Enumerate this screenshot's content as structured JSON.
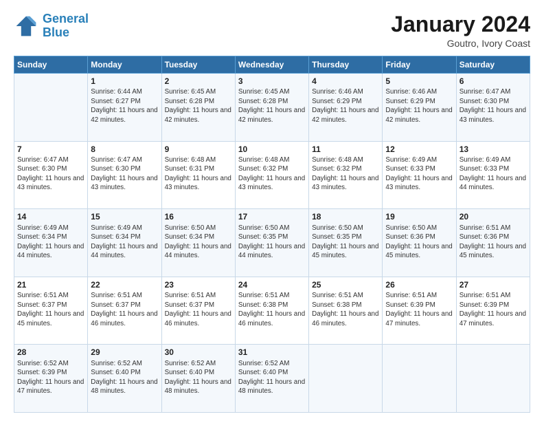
{
  "header": {
    "logo_line1": "General",
    "logo_line2": "Blue",
    "month": "January 2024",
    "location": "Goutro, Ivory Coast"
  },
  "days_of_week": [
    "Sunday",
    "Monday",
    "Tuesday",
    "Wednesday",
    "Thursday",
    "Friday",
    "Saturday"
  ],
  "weeks": [
    [
      {
        "day": "",
        "sunrise": "",
        "sunset": "",
        "daylight": ""
      },
      {
        "day": "1",
        "sunrise": "Sunrise: 6:44 AM",
        "sunset": "Sunset: 6:27 PM",
        "daylight": "Daylight: 11 hours and 42 minutes."
      },
      {
        "day": "2",
        "sunrise": "Sunrise: 6:45 AM",
        "sunset": "Sunset: 6:28 PM",
        "daylight": "Daylight: 11 hours and 42 minutes."
      },
      {
        "day": "3",
        "sunrise": "Sunrise: 6:45 AM",
        "sunset": "Sunset: 6:28 PM",
        "daylight": "Daylight: 11 hours and 42 minutes."
      },
      {
        "day": "4",
        "sunrise": "Sunrise: 6:46 AM",
        "sunset": "Sunset: 6:29 PM",
        "daylight": "Daylight: 11 hours and 42 minutes."
      },
      {
        "day": "5",
        "sunrise": "Sunrise: 6:46 AM",
        "sunset": "Sunset: 6:29 PM",
        "daylight": "Daylight: 11 hours and 42 minutes."
      },
      {
        "day": "6",
        "sunrise": "Sunrise: 6:47 AM",
        "sunset": "Sunset: 6:30 PM",
        "daylight": "Daylight: 11 hours and 43 minutes."
      }
    ],
    [
      {
        "day": "7",
        "sunrise": "Sunrise: 6:47 AM",
        "sunset": "Sunset: 6:30 PM",
        "daylight": "Daylight: 11 hours and 43 minutes."
      },
      {
        "day": "8",
        "sunrise": "Sunrise: 6:47 AM",
        "sunset": "Sunset: 6:30 PM",
        "daylight": "Daylight: 11 hours and 43 minutes."
      },
      {
        "day": "9",
        "sunrise": "Sunrise: 6:48 AM",
        "sunset": "Sunset: 6:31 PM",
        "daylight": "Daylight: 11 hours and 43 minutes."
      },
      {
        "day": "10",
        "sunrise": "Sunrise: 6:48 AM",
        "sunset": "Sunset: 6:32 PM",
        "daylight": "Daylight: 11 hours and 43 minutes."
      },
      {
        "day": "11",
        "sunrise": "Sunrise: 6:48 AM",
        "sunset": "Sunset: 6:32 PM",
        "daylight": "Daylight: 11 hours and 43 minutes."
      },
      {
        "day": "12",
        "sunrise": "Sunrise: 6:49 AM",
        "sunset": "Sunset: 6:33 PM",
        "daylight": "Daylight: 11 hours and 43 minutes."
      },
      {
        "day": "13",
        "sunrise": "Sunrise: 6:49 AM",
        "sunset": "Sunset: 6:33 PM",
        "daylight": "Daylight: 11 hours and 44 minutes."
      }
    ],
    [
      {
        "day": "14",
        "sunrise": "Sunrise: 6:49 AM",
        "sunset": "Sunset: 6:34 PM",
        "daylight": "Daylight: 11 hours and 44 minutes."
      },
      {
        "day": "15",
        "sunrise": "Sunrise: 6:49 AM",
        "sunset": "Sunset: 6:34 PM",
        "daylight": "Daylight: 11 hours and 44 minutes."
      },
      {
        "day": "16",
        "sunrise": "Sunrise: 6:50 AM",
        "sunset": "Sunset: 6:34 PM",
        "daylight": "Daylight: 11 hours and 44 minutes."
      },
      {
        "day": "17",
        "sunrise": "Sunrise: 6:50 AM",
        "sunset": "Sunset: 6:35 PM",
        "daylight": "Daylight: 11 hours and 44 minutes."
      },
      {
        "day": "18",
        "sunrise": "Sunrise: 6:50 AM",
        "sunset": "Sunset: 6:35 PM",
        "daylight": "Daylight: 11 hours and 45 minutes."
      },
      {
        "day": "19",
        "sunrise": "Sunrise: 6:50 AM",
        "sunset": "Sunset: 6:36 PM",
        "daylight": "Daylight: 11 hours and 45 minutes."
      },
      {
        "day": "20",
        "sunrise": "Sunrise: 6:51 AM",
        "sunset": "Sunset: 6:36 PM",
        "daylight": "Daylight: 11 hours and 45 minutes."
      }
    ],
    [
      {
        "day": "21",
        "sunrise": "Sunrise: 6:51 AM",
        "sunset": "Sunset: 6:37 PM",
        "daylight": "Daylight: 11 hours and 45 minutes."
      },
      {
        "day": "22",
        "sunrise": "Sunrise: 6:51 AM",
        "sunset": "Sunset: 6:37 PM",
        "daylight": "Daylight: 11 hours and 46 minutes."
      },
      {
        "day": "23",
        "sunrise": "Sunrise: 6:51 AM",
        "sunset": "Sunset: 6:37 PM",
        "daylight": "Daylight: 11 hours and 46 minutes."
      },
      {
        "day": "24",
        "sunrise": "Sunrise: 6:51 AM",
        "sunset": "Sunset: 6:38 PM",
        "daylight": "Daylight: 11 hours and 46 minutes."
      },
      {
        "day": "25",
        "sunrise": "Sunrise: 6:51 AM",
        "sunset": "Sunset: 6:38 PM",
        "daylight": "Daylight: 11 hours and 46 minutes."
      },
      {
        "day": "26",
        "sunrise": "Sunrise: 6:51 AM",
        "sunset": "Sunset: 6:39 PM",
        "daylight": "Daylight: 11 hours and 47 minutes."
      },
      {
        "day": "27",
        "sunrise": "Sunrise: 6:51 AM",
        "sunset": "Sunset: 6:39 PM",
        "daylight": "Daylight: 11 hours and 47 minutes."
      }
    ],
    [
      {
        "day": "28",
        "sunrise": "Sunrise: 6:52 AM",
        "sunset": "Sunset: 6:39 PM",
        "daylight": "Daylight: 11 hours and 47 minutes."
      },
      {
        "day": "29",
        "sunrise": "Sunrise: 6:52 AM",
        "sunset": "Sunset: 6:40 PM",
        "daylight": "Daylight: 11 hours and 48 minutes."
      },
      {
        "day": "30",
        "sunrise": "Sunrise: 6:52 AM",
        "sunset": "Sunset: 6:40 PM",
        "daylight": "Daylight: 11 hours and 48 minutes."
      },
      {
        "day": "31",
        "sunrise": "Sunrise: 6:52 AM",
        "sunset": "Sunset: 6:40 PM",
        "daylight": "Daylight: 11 hours and 48 minutes."
      },
      {
        "day": "",
        "sunrise": "",
        "sunset": "",
        "daylight": ""
      },
      {
        "day": "",
        "sunrise": "",
        "sunset": "",
        "daylight": ""
      },
      {
        "day": "",
        "sunrise": "",
        "sunset": "",
        "daylight": ""
      }
    ]
  ]
}
